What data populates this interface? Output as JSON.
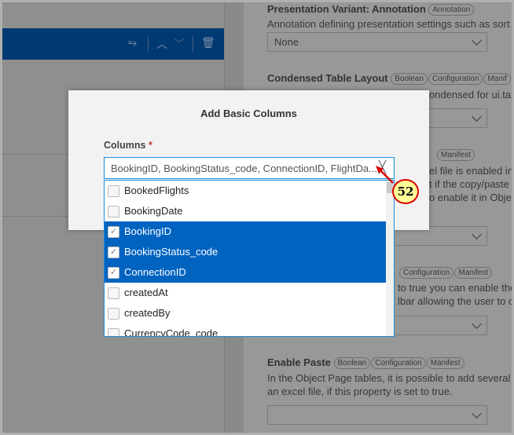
{
  "toolbar": {
    "icons": [
      "sort-icon",
      "chevron-up-icon",
      "chevron-down-icon",
      "trash-icon"
    ]
  },
  "right_panel": {
    "section1": {
      "title": "Presentation Variant: Annotation",
      "badges": [
        "Annotation"
      ],
      "description": "Annotation defining presentation settings such as sort",
      "value": "None"
    },
    "section2": {
      "title": "Condensed Table Layout",
      "badges": [
        "Boolean",
        "Configuration",
        "Manif"
      ],
      "description_visible": "ondensed for ui.tab"
    },
    "section3": {
      "badges_visible": [
        "Manifest"
      ],
      "lines_visible": [
        "el file is enabled in",
        "t if the copy/paste",
        "o enable it in Obje"
      ]
    },
    "section4": {
      "badges_visible": [
        "Configuration",
        "Manifest"
      ],
      "lines_visible": [
        "to true you can enable the",
        "lbar allowing the user to o"
      ]
    },
    "section5": {
      "title": "Enable Paste",
      "badges": [
        "Boolean",
        "Configuration",
        "Manifest"
      ],
      "lines": [
        "In the Object Page tables, it is possible to add several i",
        "an excel file, if this property is set to true."
      ],
      "value": ""
    }
  },
  "dialog": {
    "title": "Add Basic Columns",
    "columns_label": "Columns",
    "required_mark": "*",
    "input_value": "BookingID, BookingStatus_code, ConnectionID, FlightDa...",
    "options": [
      {
        "label": "BookedFlights",
        "checked": false
      },
      {
        "label": "BookingDate",
        "checked": false
      },
      {
        "label": "BookingID",
        "checked": true
      },
      {
        "label": "BookingStatus_code",
        "checked": true
      },
      {
        "label": "ConnectionID",
        "checked": true
      },
      {
        "label": "createdAt",
        "checked": false
      },
      {
        "label": "createdBy",
        "checked": false
      },
      {
        "label": "CurrencyCode_code",
        "checked": false
      }
    ]
  },
  "annotation": {
    "number": "52",
    "color": "#ffff99",
    "border": "#dd0000"
  },
  "colors": {
    "selected": "#0063c0",
    "toolbar": "#003a73"
  }
}
